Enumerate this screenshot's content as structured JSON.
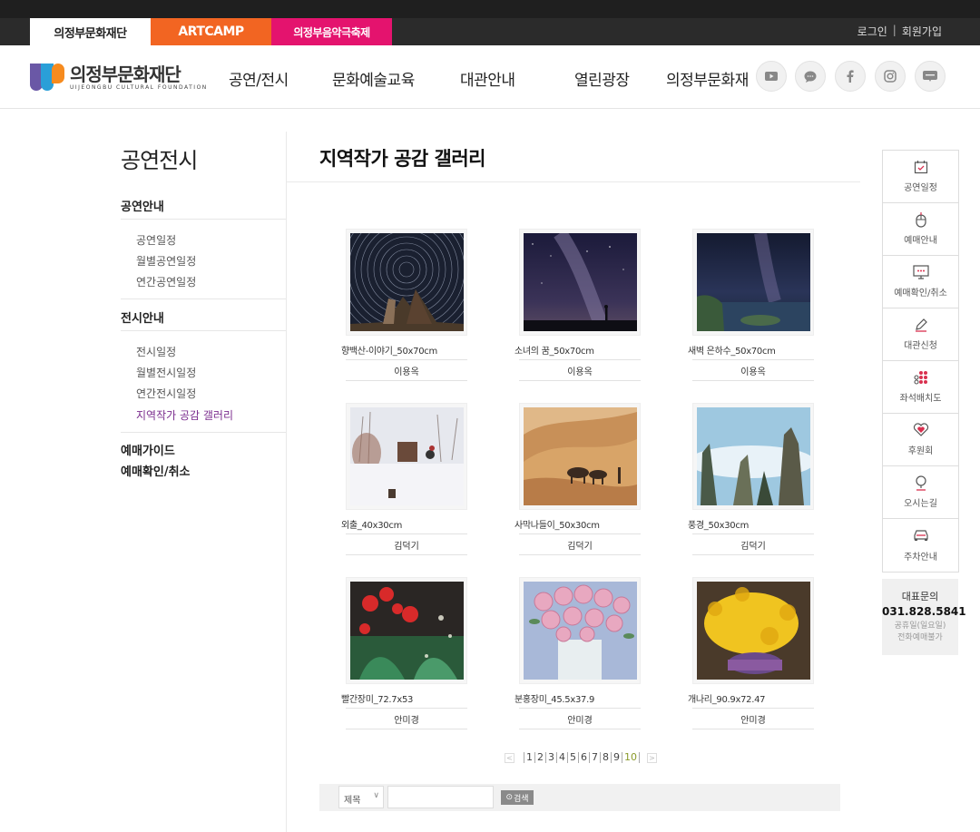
{
  "topbar": {
    "tabs": [
      "의정부문화재단",
      "ARTCAMP",
      "의정부음악극축제"
    ],
    "links": [
      "로그인",
      "|",
      "회원가입"
    ]
  },
  "header": {
    "logo_text": "의정부문화재단",
    "logo_subtext": "UIJEONGBU CULTURAL FOUNDATION",
    "nav": [
      "공연/전시",
      "문화예술교육",
      "대관안내",
      "열린광장",
      "의정부문화재"
    ],
    "sns": [
      "youtube-icon",
      "chat-icon",
      "facebook-icon",
      "instagram-icon",
      "blog-icon"
    ]
  },
  "sidebar": {
    "title": "공연전시",
    "groups": [
      {
        "label": "공연안내",
        "items": [
          "공연일정",
          "월별공연일정",
          "연간공연일정"
        ]
      },
      {
        "label": "전시안내",
        "items": [
          "전시일정",
          "월별전시일정",
          "연간전시일정",
          "지역작가 공감 갤러리"
        ]
      }
    ],
    "extra": [
      "예매가이드",
      "예매확인/취소"
    ],
    "active_item": "지역작가 공감 갤러리"
  },
  "main": {
    "title": "지역작가 공감 갤러리",
    "gallery": [
      {
        "caption": "향백산-이야기_50x70cm",
        "author": "이용옥",
        "scene": "startrail"
      },
      {
        "caption": "소녀의 꿈_50x70cm",
        "author": "이용옥",
        "scene": "milkyway"
      },
      {
        "caption": "새벽 은하수_50x70cm",
        "author": "이용옥",
        "scene": "seanight"
      },
      {
        "caption": "외출_40x30cm",
        "author": "김덕기",
        "scene": "snow"
      },
      {
        "caption": "사막나들이_50x30cm",
        "author": "김덕기",
        "scene": "desert"
      },
      {
        "caption": "풍경_50x30cm",
        "author": "김덕기",
        "scene": "peaks"
      },
      {
        "caption": "빨간장미_72.7x53",
        "author": "안미경",
        "scene": "redrose"
      },
      {
        "caption": "분홍장미_45.5x37.9",
        "author": "안미경",
        "scene": "pinkrose"
      },
      {
        "caption": "개나리_90.9x72.47",
        "author": "안미경",
        "scene": "forsythia"
      }
    ],
    "pagination": {
      "pages": [
        "1",
        "2",
        "3",
        "4",
        "5",
        "6",
        "7",
        "8",
        "9",
        "10"
      ],
      "current": "10",
      "prev": "<",
      "next": ">"
    },
    "search": {
      "select_value": "제목",
      "input_value": "",
      "button_label": "검색"
    }
  },
  "quick_menu": {
    "items": [
      {
        "label": "공연일정",
        "icon": "calendar-icon"
      },
      {
        "label": "예매안내",
        "icon": "mouse-icon"
      },
      {
        "label": "예매확인/취소",
        "icon": "monitor-icon"
      },
      {
        "label": "대관신청",
        "icon": "pencil-icon"
      },
      {
        "label": "좌석배치도",
        "icon": "seats-icon"
      },
      {
        "label": "후원회",
        "icon": "heart-icon"
      },
      {
        "label": "오시는길",
        "icon": "location-icon"
      },
      {
        "label": "주차안내",
        "icon": "car-icon"
      }
    ],
    "contact": {
      "label": "대표문의",
      "phone": "031.828.5841",
      "note1": "공휴일(일요일)",
      "note2": "전화예매불가"
    }
  }
}
